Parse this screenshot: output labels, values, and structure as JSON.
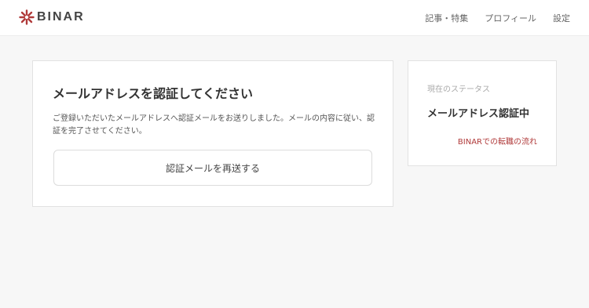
{
  "brand": {
    "name": "BINAR",
    "accent_color": "#b03a3a",
    "logo_icon": "star-burst-icon"
  },
  "nav": {
    "items": [
      "記事・特集",
      "プロフィール",
      "設定"
    ]
  },
  "main": {
    "title": "メールアドレスを認証してください",
    "description": "ご登録いただいたメールアドレスへ認証メールをお送りしました。メールの内容に従い、認証を完了させてください。",
    "resend_label": "認証メールを再送する"
  },
  "sidebar": {
    "label": "現在のステータス",
    "status": "メールアドレス認証中",
    "link_label": "BINARでの転職の流れ"
  }
}
